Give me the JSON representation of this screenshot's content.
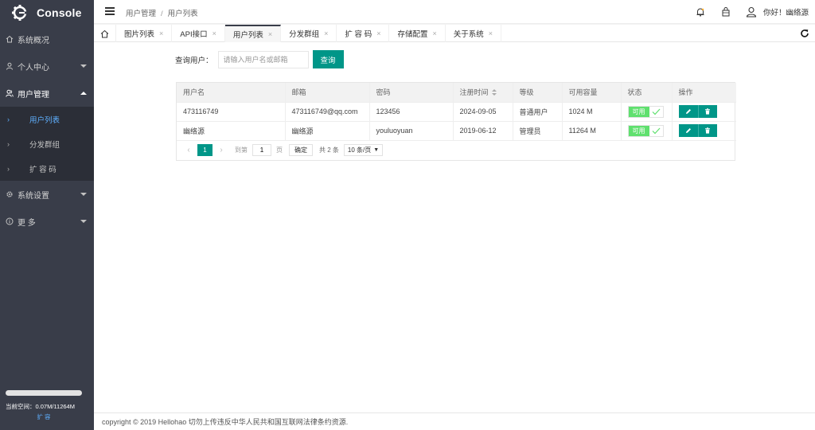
{
  "app": {
    "logo_text": "Console"
  },
  "sidebar": {
    "items": [
      {
        "label": "系统概况",
        "icon": "home-icon"
      },
      {
        "label": "个人中心",
        "icon": "user-icon"
      },
      {
        "label": "用户管理",
        "icon": "users-icon",
        "expanded": true,
        "children": [
          {
            "label": "用户列表",
            "active": true
          },
          {
            "label": "分发群组"
          },
          {
            "label": "扩 容 码"
          }
        ]
      },
      {
        "label": "系统设置",
        "icon": "gear-icon"
      },
      {
        "label": "更 多",
        "icon": "info-icon"
      }
    ],
    "storage": {
      "used_fraction": 0.0001,
      "text": "当前空间：0.07M/11264M",
      "expand_label": "扩 容"
    }
  },
  "header": {
    "breadcrumb": [
      "用户管理",
      "用户列表"
    ],
    "greeting": "你好！幽络源"
  },
  "tabs": [
    {
      "label": "图片列表"
    },
    {
      "label": "API接口"
    },
    {
      "label": "用户列表",
      "active": true
    },
    {
      "label": "分发群组"
    },
    {
      "label": "扩 容 码"
    },
    {
      "label": "存储配置"
    },
    {
      "label": "关于系统"
    }
  ],
  "search": {
    "label": "查询用户：",
    "placeholder": "请输入用户名或邮箱",
    "button": "查询"
  },
  "table": {
    "columns": [
      "用户名",
      "邮箱",
      "密码",
      "注册时间",
      "等级",
      "可用容量",
      "状态",
      "操作"
    ],
    "rows": [
      {
        "username": "473116749",
        "email": "473116749@qq.com",
        "password": "123456",
        "registered": "2024-09-05",
        "level": "普通用户",
        "capacity": "1024 M",
        "status": "可用"
      },
      {
        "username": "幽络源",
        "email": "幽络源",
        "password": "youluoyuan",
        "registered": "2019-06-12",
        "level": "管理员",
        "capacity": "11264 M",
        "status": "可用"
      }
    ]
  },
  "pager": {
    "current": "1",
    "goto_label": "到第",
    "goto_value": "1",
    "page_unit": "页",
    "confirm": "确定",
    "total": "共 2 条",
    "page_size": "10 条/页"
  },
  "footer": {
    "text": "copyright © 2019 Hellohao 切勿上传违反中华人民共和国互联网法律条约资源."
  },
  "colors": {
    "sidebar": "#393d49",
    "accent": "#009688",
    "status_on": "#5fe06e",
    "active_link": "#5fb0ff"
  }
}
